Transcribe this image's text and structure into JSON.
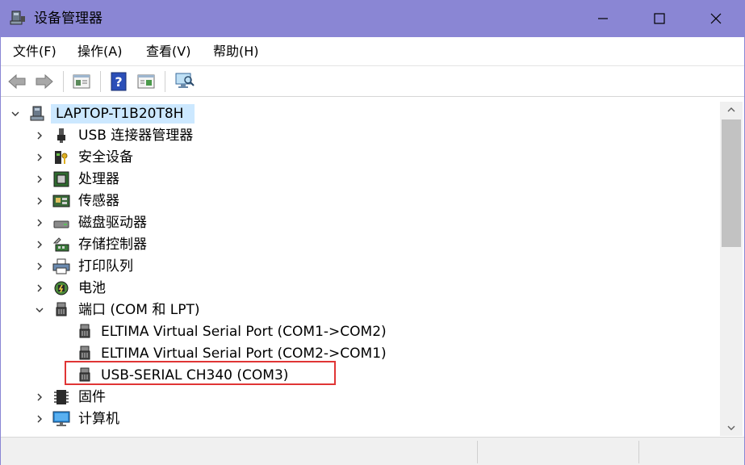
{
  "window": {
    "title": "设备管理器",
    "minimize_icon": "minimize-icon",
    "maximize_icon": "maximize-icon",
    "close_icon": "close-icon"
  },
  "menu": [
    "文件(F)",
    "操作(A)",
    "查看(V)",
    "帮助(H)"
  ],
  "toolbar": {
    "buttons": [
      "back-icon",
      "forward-icon",
      "properties-icon",
      "help-icon",
      "show-hidden-icon",
      "scan-hardware-icon"
    ]
  },
  "tree": {
    "root": "LAPTOP-T1B20T8H",
    "categories": [
      "USB 连接器管理器",
      "安全设备",
      "处理器",
      "传感器",
      "磁盘驱动器",
      "存储控制器",
      "打印队列",
      "电池",
      "端口 (COM 和 LPT)"
    ],
    "ports": [
      "ELTIMA Virtual Serial Port (COM1->COM2)",
      "ELTIMA Virtual Serial Port (COM2->COM1)",
      "USB-SERIAL CH340 (COM3)"
    ],
    "after": [
      "固件",
      "计算机"
    ]
  },
  "colors": {
    "titlebar": "#8a86d4",
    "selection": "#cce8ff",
    "highlight_box": "#e03535"
  }
}
